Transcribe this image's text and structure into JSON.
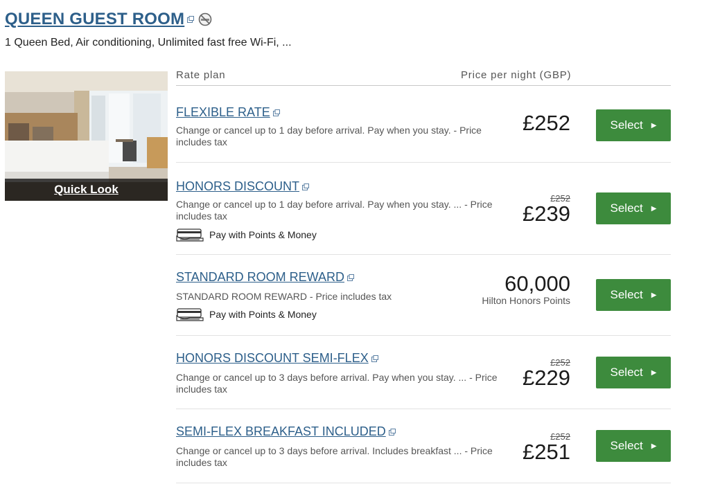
{
  "room": {
    "title": "QUEEN GUEST ROOM",
    "description": "1 Queen Bed, Air conditioning, Unlimited fast free Wi-Fi, ...",
    "quick_look": "Quick Look"
  },
  "table": {
    "col_rate_plan": "Rate plan",
    "col_price": "Price per night (GBP)"
  },
  "select_label": "Select",
  "pay_points_label": "Pay with Points & Money",
  "rates": [
    {
      "name": "FLEXIBLE RATE",
      "description": "Change or cancel up to 1 day before arrival. Pay when you stay. - Price includes tax",
      "old_price": "",
      "price": "£252",
      "sub_label": ""
    },
    {
      "name": "HONORS DISCOUNT",
      "description": "Change or cancel up to 1 day before arrival. Pay when you stay. ... - Price includes tax",
      "old_price": "£252",
      "price": "£239",
      "sub_label": ""
    },
    {
      "name": "STANDARD ROOM REWARD",
      "description": "STANDARD ROOM REWARD - Price includes tax",
      "old_price": "",
      "price": "60,000",
      "sub_label": "Hilton Honors Points"
    },
    {
      "name": "HONORS DISCOUNT SEMI-FLEX",
      "description": "Change or cancel up to 3 days before arrival. Pay when you stay. ... - Price includes tax",
      "old_price": "£252",
      "price": "£229",
      "sub_label": ""
    },
    {
      "name": "SEMI-FLEX BREAKFAST INCLUDED",
      "description": "Change or cancel up to 3 days before arrival. Includes breakfast ... - Price includes tax",
      "old_price": "£252",
      "price": "£251",
      "sub_label": ""
    }
  ],
  "colors": {
    "link": "#2d5f8a",
    "button": "#3d8b3d"
  },
  "icons": [
    "external-link-icon",
    "no-smoking-icon",
    "points-money-icon",
    "caret-right-icon"
  ]
}
